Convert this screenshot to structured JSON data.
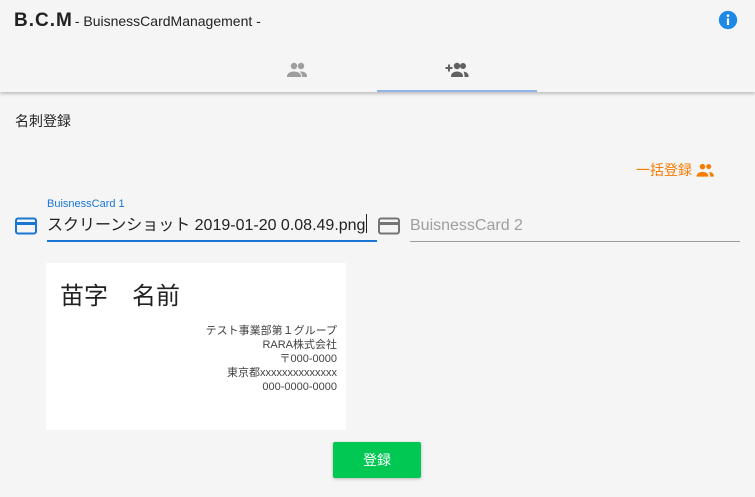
{
  "header": {
    "brand": "B.C.M",
    "subtitle": "- BuisnessCardManagement -",
    "info_icon": "info-icon",
    "tabs": [
      {
        "icon": "people-icon",
        "active": false
      },
      {
        "icon": "person-add-icon",
        "active": true
      }
    ]
  },
  "page_title": "名刺登録",
  "bulk_register": {
    "label": "一括登録",
    "icon": "group-icon",
    "color": "#f57c00"
  },
  "fields": [
    {
      "label": "BuisnessCard 1",
      "value": "スクリーンショット 2019-01-20 0.08.49.png",
      "icon": "credit-card-icon",
      "focused": true
    },
    {
      "placeholder": "BuisnessCard 2",
      "value": "",
      "icon": "credit-card-icon",
      "focused": false
    }
  ],
  "card_preview": {
    "name": "苗字　名前",
    "lines": [
      "テスト事業部第１グループ",
      "RARA株式会社",
      "〒000-0000",
      "東京都xxxxxxxxxxxxxx",
      "000-0000-0000"
    ]
  },
  "register_button": {
    "label": "登録",
    "color": "#00c853"
  },
  "colors": {
    "accent": "#1976d2",
    "orange": "#f57c00",
    "green": "#00c853"
  }
}
